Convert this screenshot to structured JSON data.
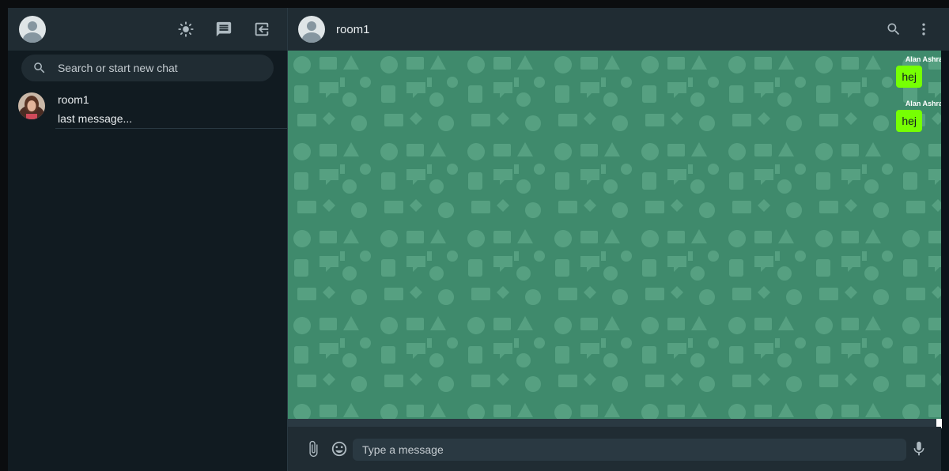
{
  "sidebar": {
    "header": {
      "icons": [
        "user-avatar",
        "sun-icon",
        "chat-icon",
        "logout-icon"
      ]
    },
    "search": {
      "placeholder": "Search or start new chat"
    },
    "chats": [
      {
        "name": "room1",
        "last_message": "last message..."
      }
    ]
  },
  "main": {
    "header": {
      "title": "room1",
      "icons": [
        "search-icon",
        "more-vert-icon"
      ]
    },
    "messages": [
      {
        "sender": "Alan Ashra",
        "text": "hej"
      },
      {
        "sender": "Alan Ashra",
        "text": "hej"
      }
    ],
    "footer": {
      "placeholder": "Type a message",
      "icons": [
        "attach-icon",
        "emoji-icon",
        "mic-icon"
      ]
    }
  },
  "colors": {
    "sidebar_bg": "#111b21",
    "header_bg": "#202c33",
    "wallpaper": "#3f8a6c",
    "bubble": "#76ff03"
  }
}
